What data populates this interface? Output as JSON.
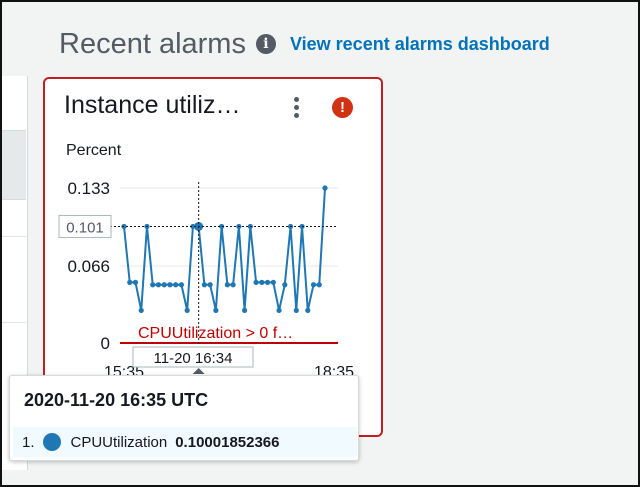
{
  "header": {
    "title": "Recent alarms",
    "info_icon": "info-icon",
    "link_label": "View recent alarms dashboard"
  },
  "card": {
    "title": "Instance utiliz…",
    "menu_icon": "kebab-menu-icon",
    "alarm_icon": "alarm-exclamation-icon",
    "unit": "Percent",
    "colors": {
      "border": "#c02020",
      "line": "#1f77b4",
      "threshold": "#c00000"
    }
  },
  "chart_data": {
    "type": "line",
    "ylabel": "Percent",
    "ylim": [
      0,
      0.133
    ],
    "y_ticks": [
      "0.133",
      "0.066",
      "0"
    ],
    "x_ticks": [
      "15:35",
      "18:35"
    ],
    "crosshair": {
      "y_label": "0.101",
      "x_label": "11-20 16:34",
      "index": 13
    },
    "threshold": {
      "label": "CPUUtilization > 0 f…",
      "value": 0
    },
    "series": [
      {
        "name": "CPUUtilization",
        "values": [
          0.1,
          0.052,
          0.052,
          0.028,
          0.1,
          0.05,
          0.05,
          0.05,
          0.05,
          0.05,
          0.05,
          0.028,
          0.1,
          0.1,
          0.05,
          0.05,
          0.028,
          0.1,
          0.05,
          0.05,
          0.1,
          0.028,
          0.1,
          0.052,
          0.052,
          0.052,
          0.052,
          0.028,
          0.05,
          0.1,
          0.028,
          0.1,
          0.028,
          0.05,
          0.05,
          0.133
        ]
      }
    ]
  },
  "tooltip": {
    "timestamp": "2020-11-20 16:35 UTC",
    "row_index": "1.",
    "metric": "CPUUtilization",
    "value": "0.10001852366"
  }
}
